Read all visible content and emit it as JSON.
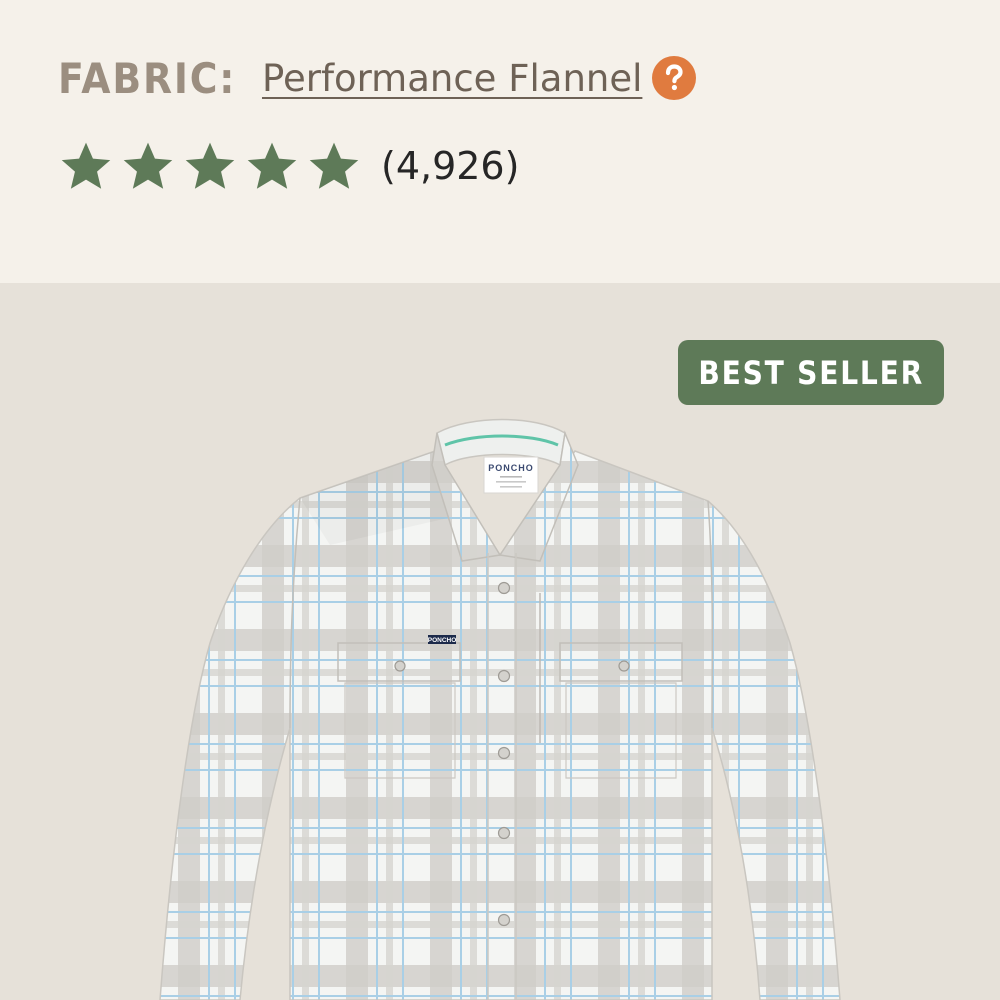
{
  "product": {
    "fabric_label": "FABRIC:",
    "fabric_value": "Performance Flannel",
    "help_icon": "question-circle-icon",
    "rating": {
      "stars": 5,
      "max_stars": 5,
      "review_count": "(4,926)",
      "star_icon": "star-icon"
    },
    "badge": "BEST SELLER",
    "shirt_brand_label": "PONCHO",
    "chest_logo": "PONCHO"
  },
  "colors": {
    "info_background": "#f5f1ea",
    "product_background": "#e6e1d9",
    "fabric_label": "#9b8e80",
    "link_text": "#6e6256",
    "help_icon": "#e07b3f",
    "star": "#5e7a58",
    "badge_background": "#5e7a58",
    "badge_text": "#ffffff"
  }
}
